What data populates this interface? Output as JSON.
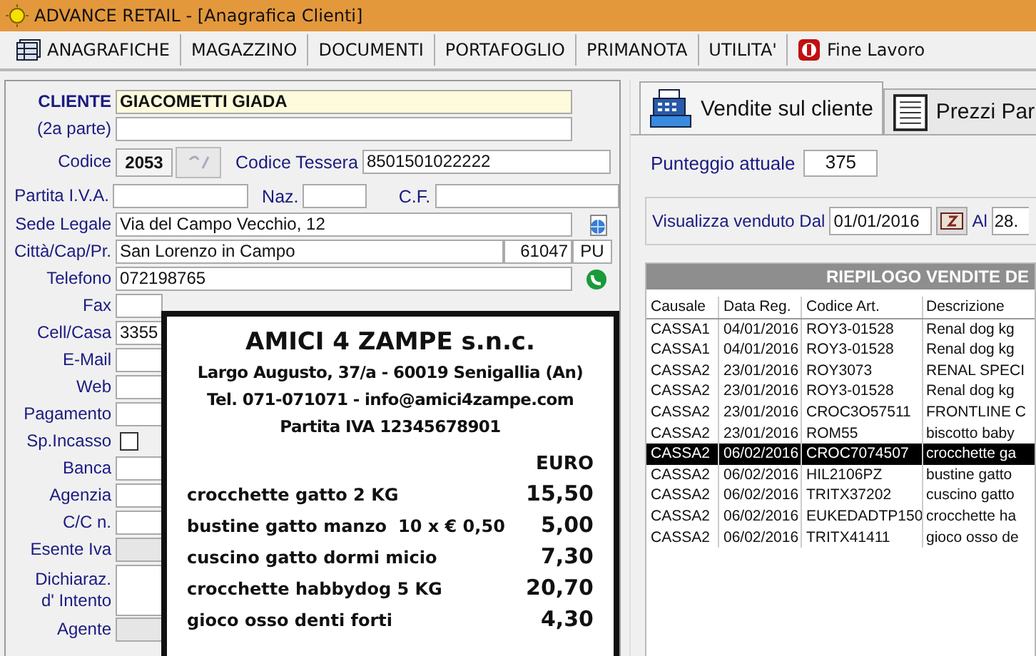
{
  "window": {
    "title": "ADVANCE RETAIL  - [Anagrafica Clienti]"
  },
  "menu": [
    {
      "label": "ANAGRAFICHE",
      "kind": "grid"
    },
    {
      "label": "MAGAZZINO",
      "kind": "plain"
    },
    {
      "label": "DOCUMENTI",
      "kind": "plain"
    },
    {
      "label": "PORTAFOGLIO",
      "kind": "plain"
    },
    {
      "label": "PRIMANOTA",
      "kind": "plain"
    },
    {
      "label": "UTILITA'",
      "kind": "plain"
    },
    {
      "label": "Fine Lavoro",
      "kind": "exit"
    }
  ],
  "form": [
    {
      "kind": "text",
      "label": "CLIENTE",
      "value": "GIACOMETTI GIADA",
      "focused": true,
      "disabled": false
    },
    {
      "kind": "text",
      "label": "(2a parte)",
      "focused": false,
      "disabled": false
    },
    {
      "kind": "codice",
      "label": "Codice",
      "value": "2053",
      "label2": "Codice Tessera",
      "value2": "8501501022222"
    },
    {
      "kind": "triple",
      "label": "Partita I.V.A.",
      "label2": "Naz.",
      "label3": "C.F."
    },
    {
      "kind": "address",
      "label": "Sede Legale",
      "value": "Via del Campo Vecchio, 12"
    },
    {
      "kind": "city",
      "label": "Città/Cap/Pr.",
      "value": "San Lorenzo in Campo",
      "cap": "61047",
      "prov": "PU"
    },
    {
      "kind": "phone",
      "label": "Telefono",
      "value": "072198765"
    },
    {
      "kind": "text",
      "label": "Fax",
      "focused": false,
      "disabled": false
    },
    {
      "kind": "text",
      "label": "Cell/Casa",
      "value": "3355",
      "focused": false,
      "disabled": false
    },
    {
      "kind": "text",
      "label": "E-Mail",
      "focused": false,
      "disabled": false
    },
    {
      "kind": "text",
      "label": "Web",
      "focused": false,
      "disabled": false
    },
    {
      "kind": "text",
      "label": "Pagamento",
      "focused": false,
      "disabled": false
    },
    {
      "kind": "checkbox",
      "label": "Sp.Incasso",
      "checked": false
    },
    {
      "kind": "text",
      "label": "Banca",
      "focused": false,
      "disabled": false
    },
    {
      "kind": "text",
      "label": "Agenzia",
      "focused": false,
      "disabled": false
    },
    {
      "kind": "text",
      "label": "C/C n.",
      "focused": false,
      "disabled": false
    },
    {
      "kind": "text",
      "label": "Esente Iva",
      "focused": false,
      "disabled": true
    },
    {
      "kind": "tall",
      "label": "Dichiaraz.\nd' Intento"
    },
    {
      "kind": "text",
      "label": "Agente",
      "focused": false,
      "disabled": true
    }
  ],
  "receipt": {
    "title": "AMICI 4 ZAMPE s.n.c.",
    "header": [
      "Largo Augusto, 37/a - 60019 Senigallia (An)",
      "Tel. 071-071071  -  info@amici4zampe.com",
      "Partita IVA  12345678901"
    ],
    "currency": "EURO",
    "items": [
      {
        "name": "crocchette gatto 2 KG",
        "price": "15,50"
      },
      {
        "name": "bustine gatto manzo",
        "qty": "10 x € 0,50",
        "price": "5,00"
      },
      {
        "name": "cuscino gatto dormi micio",
        "price": "7,30"
      },
      {
        "name": "crocchette habbydog 5 KG",
        "price": "20,70"
      },
      {
        "name": "gioco osso denti forti",
        "price": "4,30"
      }
    ]
  },
  "tabs": [
    {
      "label": "Vendite sul cliente",
      "kind": "register",
      "selected": true
    },
    {
      "label": "Prezzi Par",
      "kind": "list",
      "selected": false
    }
  ],
  "punteggio": {
    "label": "Punteggio attuale",
    "value": "375"
  },
  "filter": {
    "label": "Visualizza venduto Dal",
    "from": "01/01/2016",
    "to_label": "Al",
    "to": "28."
  },
  "table": {
    "title": "RIEPILOGO VENDITE DE",
    "columns": [
      "Causale",
      "Data Reg.",
      "Codice Art.",
      "Descrizione"
    ],
    "rows": [
      {
        "cells": [
          "CASSA1",
          "04/01/2016",
          "ROY3-01528",
          "Renal dog kg"
        ],
        "selected": false
      },
      {
        "cells": [
          "CASSA1",
          "04/01/2016",
          "ROY3-01528",
          "Renal dog kg"
        ],
        "selected": false
      },
      {
        "cells": [
          "CASSA2",
          "23/01/2016",
          "ROY3073",
          "RENAL SPECI"
        ],
        "selected": false
      },
      {
        "cells": [
          "CASSA2",
          "23/01/2016",
          "ROY3-01528",
          "Renal dog kg"
        ],
        "selected": false
      },
      {
        "cells": [
          "CASSA2",
          "23/01/2016",
          "CROC3O57511",
          "FRONTLINE C"
        ],
        "selected": false
      },
      {
        "cells": [
          "CASSA2",
          "23/01/2016",
          "ROM55",
          "biscotto baby"
        ],
        "selected": false
      },
      {
        "cells": [
          "CASSA2",
          "06/02/2016",
          "CROC7074507",
          "crocchette ga"
        ],
        "selected": true
      },
      {
        "cells": [
          "CASSA2",
          "06/02/2016",
          "HIL2106PZ",
          "bustine gatto"
        ],
        "selected": false
      },
      {
        "cells": [
          "CASSA2",
          "06/02/2016",
          "TRITX37202",
          "cuscino gatto"
        ],
        "selected": false
      },
      {
        "cells": [
          "CASSA2",
          "06/02/2016",
          "EUKEDADTP150",
          "crocchette ha"
        ],
        "selected": false
      },
      {
        "cells": [
          "CASSA2",
          "06/02/2016",
          "TRITX41411",
          "gioco osso de"
        ],
        "selected": false
      }
    ]
  }
}
